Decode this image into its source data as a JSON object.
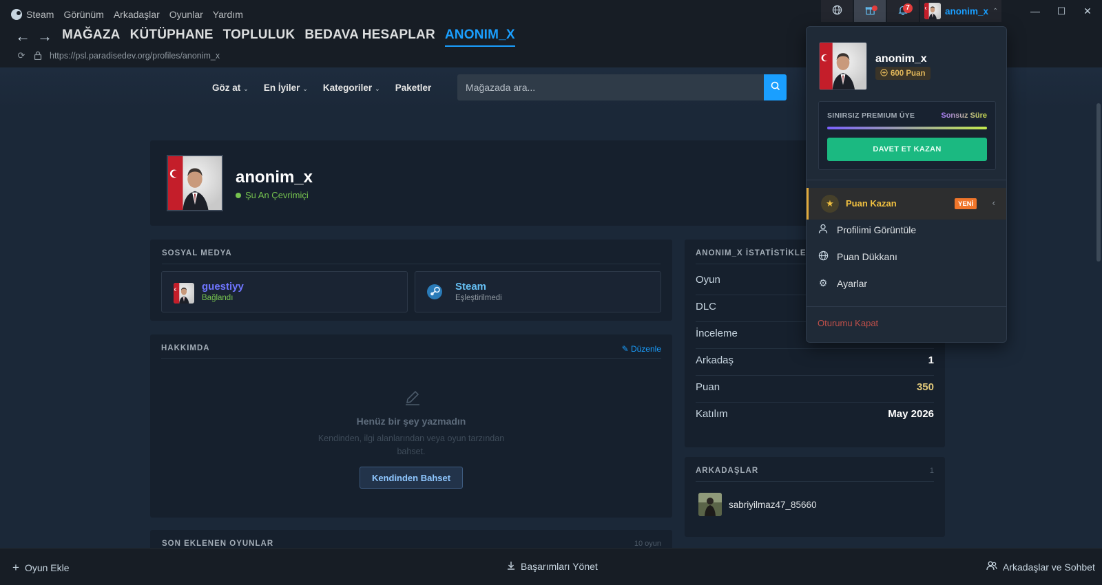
{
  "menu": {
    "app": "Steam",
    "items": [
      "Görünüm",
      "Arkadaşlar",
      "Oyunlar",
      "Yardım"
    ]
  },
  "nav": {
    "links": [
      "MAĞAZA",
      "KÜTÜPHANE",
      "TOPLULUK",
      "BEDAVA HESAPLAR",
      "ANONIM_X"
    ],
    "active": "ANONIM_X"
  },
  "url": "https://psl.paradisedev.org/profiles/anonim_x",
  "topbar": {
    "username": "anonim_x",
    "notif_count": "7"
  },
  "store": {
    "items": [
      {
        "label": "Göz at",
        "has_caret": true
      },
      {
        "label": "En İyiler",
        "has_caret": true
      },
      {
        "label": "Kategoriler",
        "has_caret": true
      },
      {
        "label": "Paketler",
        "has_caret": false
      }
    ],
    "search_placeholder": "Mağazada ara..."
  },
  "profile": {
    "name": "anonim_x",
    "status": "Şu An Çevrimiçi"
  },
  "social": {
    "title": "SOSYAL MEDYA",
    "cards": [
      {
        "name": "guestiyy",
        "sub": "Bağlandı",
        "name_color": "#6f75ff",
        "sub_color": "#76c34f",
        "icon": "user-avatar"
      },
      {
        "name": "Steam",
        "sub": "Eşleştirilmedi",
        "name_color": "#66c0f4",
        "sub_color": "#8f98a0",
        "icon": "steam-icon"
      }
    ]
  },
  "about": {
    "title": "HAKKIMDA",
    "edit": "Düzenle",
    "empty_title": "Henüz bir şey yazmadın",
    "empty_sub": "Kendinden, ilgi alanlarından veya oyun tarzından bahset.",
    "button": "Kendinden Bahset"
  },
  "recent": {
    "title": "SON EKLENEN OYUNLAR",
    "count": "10 oyun"
  },
  "stats": {
    "title": "ANONIM_X İSTATİSTİKLERİ",
    "rows": [
      {
        "label": "Oyun",
        "value": ""
      },
      {
        "label": "DLC",
        "value": ""
      },
      {
        "label": "İnceleme",
        "value": ""
      },
      {
        "label": "Arkadaş",
        "value": "1"
      },
      {
        "label": "Puan",
        "value": "350"
      },
      {
        "label": "Katılım",
        "value": "May 2026"
      }
    ]
  },
  "friends": {
    "title": "ARKADAŞLAR",
    "count": "1",
    "list": [
      {
        "name": "sabriyilmaz47_85660"
      }
    ]
  },
  "bottom": {
    "add_game": "Oyun Ekle",
    "achievements": "Başarımları Yönet",
    "friends_chat": "Arkadaşlar ve Sohbet"
  },
  "dropdown": {
    "name": "anonim_x",
    "points": "600 Puan",
    "premium_title": "SINIRSIZ PREMIUM ÜYE",
    "premium_sub": "Sonsuz Süre",
    "invite": "DAVET ET KAZAN",
    "earn": "Puan Kazan",
    "earn_badge": "YENİ",
    "items": [
      {
        "label": "Profilimi Görüntüle",
        "icon": "user-icon"
      },
      {
        "label": "Puan Dükkanı",
        "icon": "globe-icon"
      },
      {
        "label": "Ayarlar",
        "icon": "gear-icon"
      }
    ],
    "logout": "Oturumu Kapat"
  },
  "colors": {
    "accent": "#1a9fff",
    "online": "#76c34f",
    "gold": "#e0c87a",
    "invite": "#1bb981",
    "new_badge": "#f0762b",
    "logout": "#c0504a"
  }
}
